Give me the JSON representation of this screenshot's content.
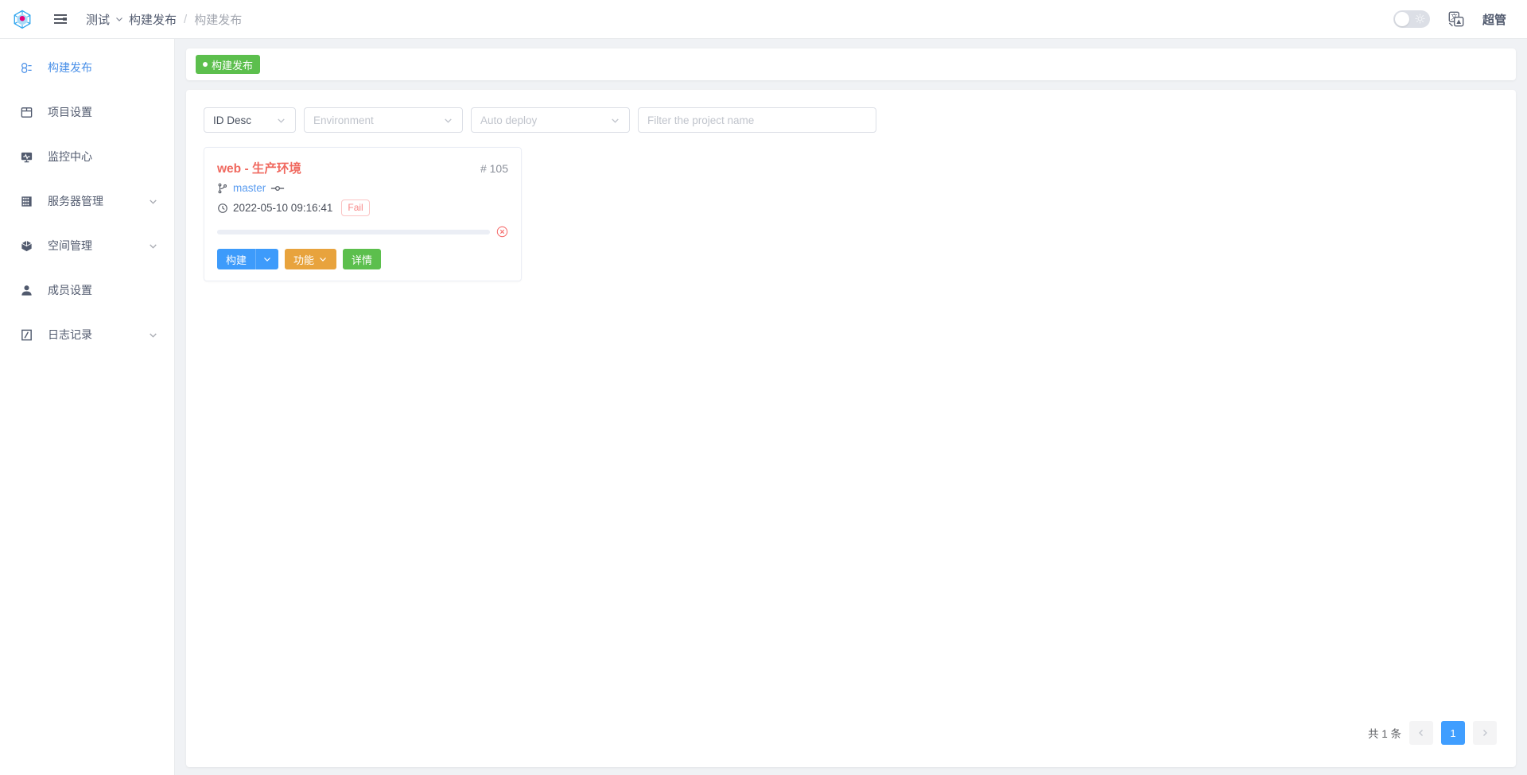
{
  "topbar": {
    "logo_icon": "cube-logo-icon",
    "menu_toggle_icon": "hamburger-icon",
    "breadcrumb": {
      "project": "测试",
      "project_caret_icon": "chevron-down-icon",
      "current": "构建发布",
      "separator": "/",
      "sub": "构建发布"
    },
    "theme_toggle_icon": "sun-icon",
    "translate_icon": "translate-icon",
    "user_name": "超管"
  },
  "sidebar": {
    "items": [
      {
        "label": "构建发布",
        "icon": "deploy-icon",
        "active": true,
        "expandable": false
      },
      {
        "label": "项目设置",
        "icon": "project-settings-icon",
        "active": false,
        "expandable": false
      },
      {
        "label": "监控中心",
        "icon": "monitor-icon",
        "active": false,
        "expandable": false
      },
      {
        "label": "服务器管理",
        "icon": "server-icon",
        "active": false,
        "expandable": true
      },
      {
        "label": "空间管理",
        "icon": "space-cube-icon",
        "active": false,
        "expandable": true
      },
      {
        "label": "成员设置",
        "icon": "user-icon",
        "active": false,
        "expandable": false
      },
      {
        "label": "日志记录",
        "icon": "log-icon",
        "active": false,
        "expandable": true
      }
    ]
  },
  "tabs": [
    {
      "label": "构建发布",
      "active": true,
      "dot_icon": "dot-icon"
    }
  ],
  "filters": {
    "sort": {
      "value": "ID Desc",
      "caret_icon": "chevron-down-icon"
    },
    "environment": {
      "placeholder": "Environment",
      "caret_icon": "chevron-down-icon"
    },
    "auto_deploy": {
      "placeholder": "Auto deploy",
      "caret_icon": "chevron-down-icon"
    },
    "search": {
      "value": "",
      "placeholder": "Filter the project name"
    }
  },
  "projects": [
    {
      "title": "web - 生产环境",
      "id_label": "# 105",
      "branch_icon": "git-branch-icon",
      "branch": "master",
      "commit_icon": "git-commit-icon",
      "time_icon": "clock-icon",
      "time": "2022-05-10 09:16:41",
      "status": "Fail",
      "progress_percent": 0,
      "progress_status_icon": "error-circle-icon",
      "actions": {
        "build": "构建",
        "build_caret_icon": "chevron-down-icon",
        "function": "功能",
        "function_caret_icon": "chevron-down-icon",
        "detail": "详情"
      }
    }
  ],
  "pagination": {
    "total_text": "共 1 条",
    "prev_icon": "chevron-left-icon",
    "next_icon": "chevron-right-icon",
    "pages": [
      "1"
    ],
    "current": "1"
  },
  "colors": {
    "accent_blue": "#409eff",
    "green": "#5cbf4d",
    "orange": "#e8a33d",
    "danger": "#f56c6c",
    "title_red": "#f0695f",
    "page_bg": "#f0f2f5"
  }
}
